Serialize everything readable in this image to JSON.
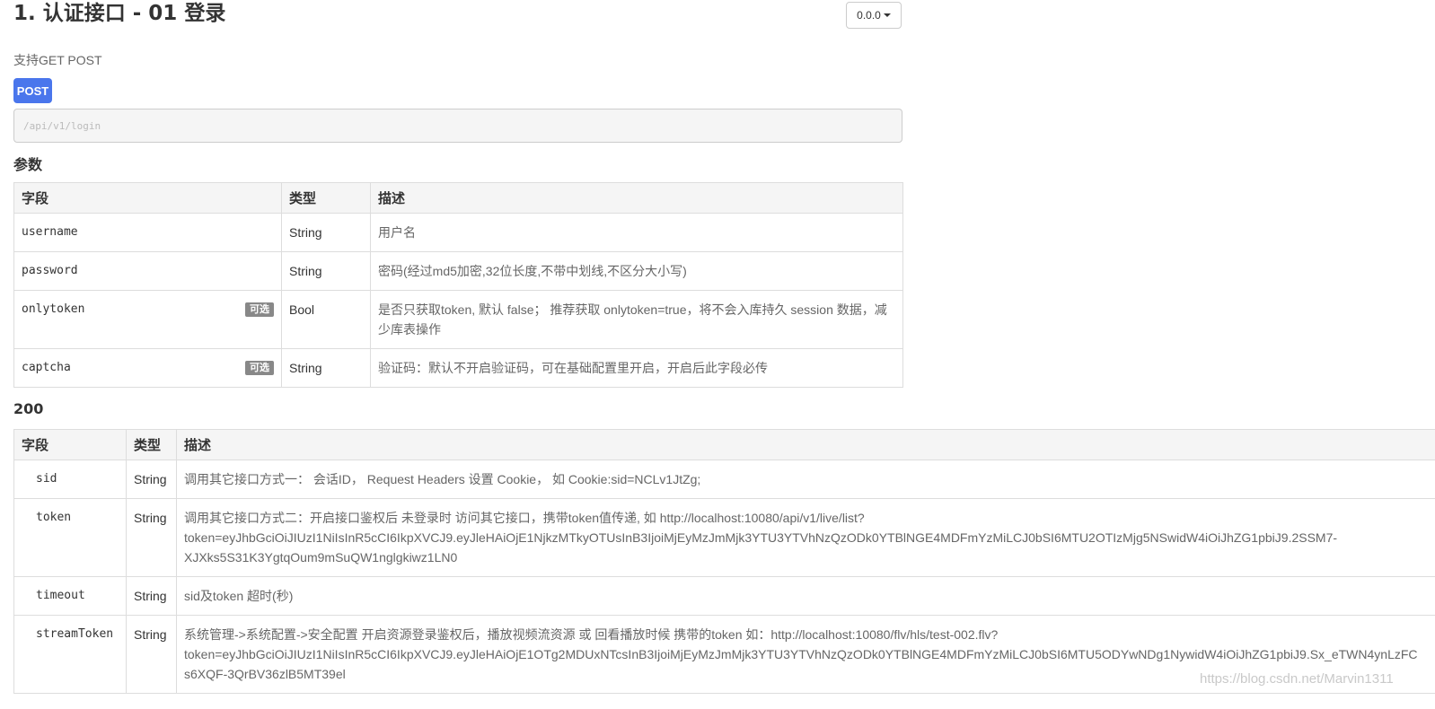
{
  "page": {
    "title": "1. 认证接口 - 01 登录",
    "version": "0.0.0",
    "support": "支持GET POST",
    "method": "POST",
    "url": "/api/v1/login"
  },
  "params": {
    "heading": "参数",
    "headers": [
      "字段",
      "类型",
      "描述"
    ],
    "optional_label": "可选",
    "rows": [
      {
        "field": "username",
        "type": "String",
        "desc": "用户名",
        "optional": false
      },
      {
        "field": "password",
        "type": "String",
        "desc": "密码(经过md5加密,32位长度,不带中划线,不区分大小写)",
        "optional": false
      },
      {
        "field": "onlytoken",
        "type": "Bool",
        "desc": "是否只获取token, 默认 false； 推荐获取 onlytoken=true，将不会入库持久 session 数据，减少库表操作",
        "optional": true
      },
      {
        "field": "captcha",
        "type": "String",
        "desc": "验证码：默认不开启验证码，可在基础配置里开启，开启后此字段必传",
        "optional": true
      }
    ]
  },
  "response": {
    "heading": "200",
    "headers": [
      "字段",
      "类型",
      "描述"
    ],
    "rows": [
      {
        "field": "sid",
        "type": "String",
        "desc": "调用其它接口方式一： 会话ID， Request Headers 设置 Cookie， 如 Cookie:sid=NCLv1JtZg;"
      },
      {
        "field": "token",
        "type": "String",
        "desc_lines": [
          "调用其它接口方式二：开启接口鉴权后 未登录时 访问其它接口，携带token值传递, 如 http://localhost:10080/api/v1/live/list?",
          "token=eyJhbGciOiJIUzI1NiIsInR5cCI6IkpXVCJ9.eyJleHAiOjE1NjkzMTkyOTUsInB3IjoiMjEyMzJmMjk3YTU3YTVhNzQzODk0YTBlNGE4MDFmYzMiLCJ0bSI6MTU2OTIzMjg5NSwidW4iOiJhZG1pbiJ9.2SSM7-",
          "XJXks5S31K3YgtqOum9mSuQW1nglgkiwz1LN0"
        ]
      },
      {
        "field": "timeout",
        "type": "String",
        "desc": "sid及token 超时(秒)"
      },
      {
        "field": "streamToken",
        "type": "String",
        "desc_lines": [
          "系统管理->系统配置->安全配置 开启资源登录鉴权后，播放视频流资源 或 回看播放时候 携带的token 如：http://localhost:10080/flv/hls/test-002.flv?",
          "token=eyJhbGciOiJIUzI1NiIsInR5cCI6IkpXVCJ9.eyJleHAiOjE1OTg2MDUxNTcsInB3IjoiMjEyMzJmMjk3YTU3YTVhNzQzODk0YTBlNGE4MDFmYzMiLCJ0bSI6MTU5ODYwNDg1NywidW4iOiJhZG1pbiJ9.Sx_eTWN4ynLzFC",
          "s6XQF-3QrBV36zlB5MT39el"
        ]
      }
    ]
  },
  "watermark": "https://blog.csdn.net/Marvin1311"
}
